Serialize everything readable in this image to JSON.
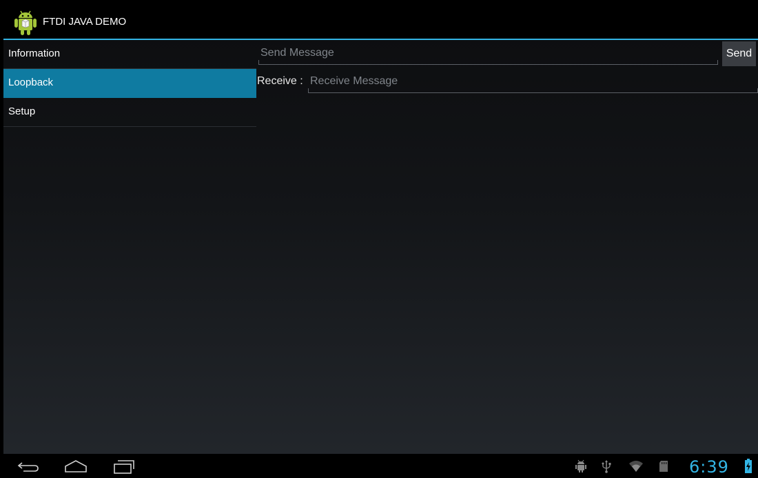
{
  "app": {
    "title": "FTDI JAVA DEMO",
    "icon": "android-app-icon"
  },
  "nav": {
    "items": [
      {
        "label": "Information",
        "selected": false
      },
      {
        "label": "Loopback",
        "selected": true
      },
      {
        "label": "Setup",
        "selected": false
      }
    ]
  },
  "loopback": {
    "send_placeholder": "Send Message",
    "send_value": "",
    "send_button": "Send",
    "receive_label": "Receive :",
    "receive_placeholder": "Receive Message",
    "receive_value": ""
  },
  "system_bar": {
    "nav_icons": [
      "back-icon",
      "home-icon",
      "recent-apps-icon"
    ],
    "status_icons": [
      "android-debug-icon",
      "usb-icon",
      "wifi-icon",
      "sd-card-icon",
      "battery-charging-icon"
    ],
    "time": "6:39"
  },
  "colors": {
    "accent": "#33b5e5",
    "selected_item": "#0f7ba1"
  }
}
